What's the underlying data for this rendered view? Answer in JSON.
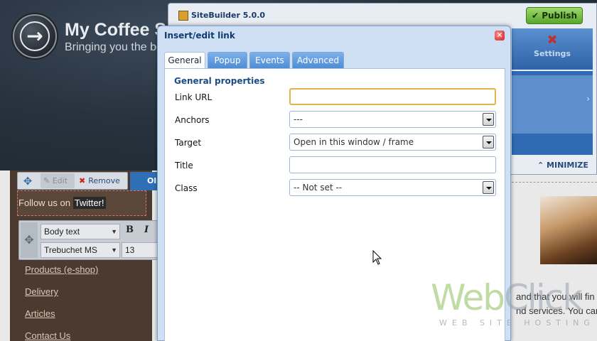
{
  "site": {
    "title": "My Coffee S",
    "tagline": "Bringing you the be",
    "edit_label": "Edit",
    "remove_label": "Remove",
    "ok_label": "Ol",
    "follow_text": "Follow us on ",
    "follow_link": "Twitter!",
    "format": {
      "style_value": "Body text",
      "font_value": "Trebuchet MS",
      "size_value": "13",
      "bold_label": "B",
      "italic_label": "I"
    },
    "links": [
      "Products (e-shop)",
      "Delivery",
      "Articles",
      "Contact Us"
    ],
    "right_text_1": "and that you will fin",
    "right_text_2": "nd services. You can"
  },
  "sitebuilder": {
    "title": "SiteBuilder 5.0.0",
    "publish_label": "Publish",
    "settings_label": "Settings",
    "minimize_label": "MINIMIZE"
  },
  "dialog": {
    "title": "Insert/edit link",
    "tabs": [
      {
        "label": "General",
        "active": true
      },
      {
        "label": "Popup",
        "active": false
      },
      {
        "label": "Events",
        "active": false
      },
      {
        "label": "Advanced",
        "active": false
      }
    ],
    "fieldset_title": "General properties",
    "fields": {
      "link_url": {
        "label": "Link URL",
        "value": ""
      },
      "anchors": {
        "label": "Anchors",
        "value": "---"
      },
      "target": {
        "label": "Target",
        "value": "Open in this window / frame"
      },
      "title": {
        "label": "Title",
        "value": ""
      },
      "class": {
        "label": "Class",
        "value": "-- Not set --"
      }
    }
  },
  "watermark": {
    "logo_part1": "Web",
    "logo_part2": "Click",
    "subtitle": "WEB SITE HOSTING"
  },
  "colors": {
    "dialog_title": "#123a6e",
    "tab_blue": "#4c8bd4",
    "publish_green": "#5aa62c",
    "focus_border": "#e0b44a"
  }
}
